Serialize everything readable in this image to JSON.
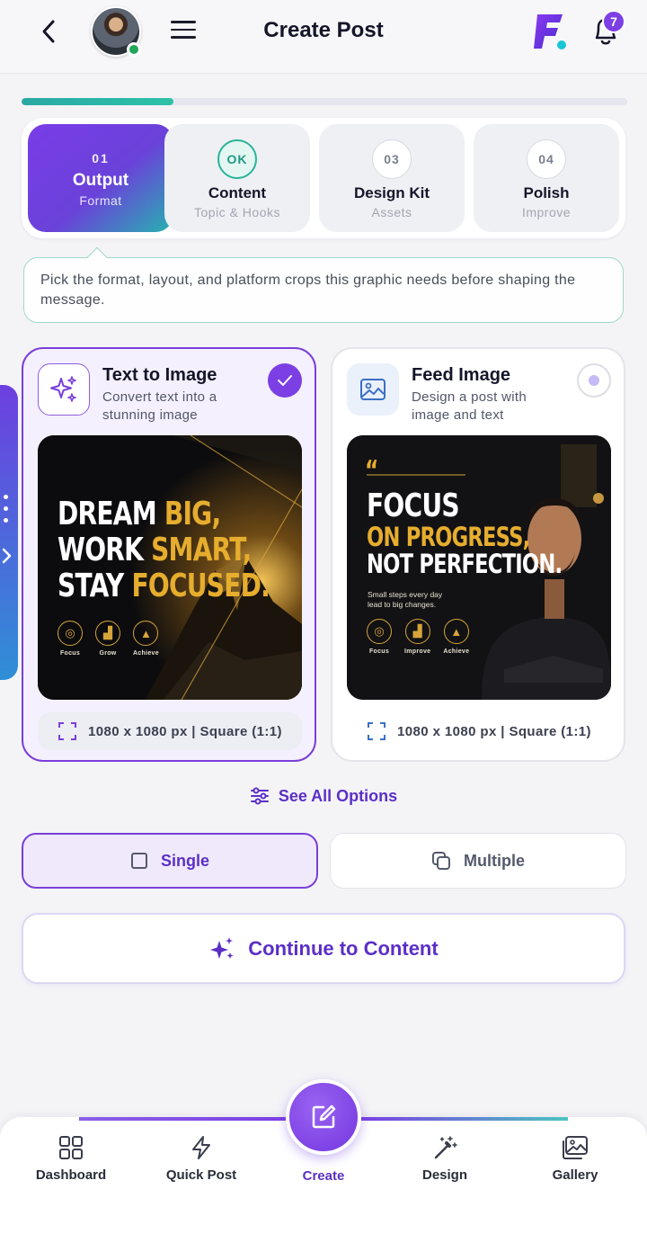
{
  "header": {
    "title": "Create Post",
    "notification_count": "7",
    "brand_letter": "F"
  },
  "progress": {
    "fraction": 0.25
  },
  "steps": [
    {
      "num": "01",
      "title": "Output",
      "sub": "Format",
      "state": "active"
    },
    {
      "num": "OK",
      "title": "Content",
      "sub": "Topic & Hooks",
      "state": "done"
    },
    {
      "num": "03",
      "title": "Design Kit",
      "sub": "Assets",
      "state": "pending"
    },
    {
      "num": "04",
      "title": "Polish",
      "sub": "Improve",
      "state": "pending"
    }
  ],
  "hint": "Pick the format, layout, and platform crops this graphic needs before shaping the message.",
  "cards": [
    {
      "title": "Text to Image",
      "desc": "Convert text into a stunning image",
      "size": "1080 x 1080 px | Square (1:1)",
      "selected": true,
      "art": {
        "line1a": "Dream ",
        "line1b": "Big,",
        "line2a": "Work ",
        "line2b": "Smart,",
        "line3a": "Stay ",
        "line3b": "Focused.",
        "icons": [
          "Focus",
          "Grow",
          "Achieve"
        ]
      }
    },
    {
      "title": "Feed Image",
      "desc": "Design a post with image and text",
      "size": "1080 x 1080 px | Square (1:1)",
      "selected": false,
      "art": {
        "quote": "“",
        "line1": "Focus",
        "line2": "On Progress,",
        "line3": "Not Perfection.",
        "small1": "Small steps every day",
        "small2": "lead to big changes.",
        "icons": [
          "Focus",
          "Improve",
          "Achieve"
        ]
      }
    }
  ],
  "see_all": "See All Options",
  "modes": {
    "single": "Single",
    "multiple": "Multiple"
  },
  "continue_label": "Continue to Content",
  "nav": {
    "dashboard": "Dashboard",
    "quick_post": "Quick Post",
    "create": "Create",
    "design": "Design",
    "gallery": "Gallery"
  },
  "colors": {
    "accent": "#7b3fe4",
    "accent_text": "#5b2fc6",
    "teal": "#2bb39a",
    "gold": "#e6ad2e"
  }
}
